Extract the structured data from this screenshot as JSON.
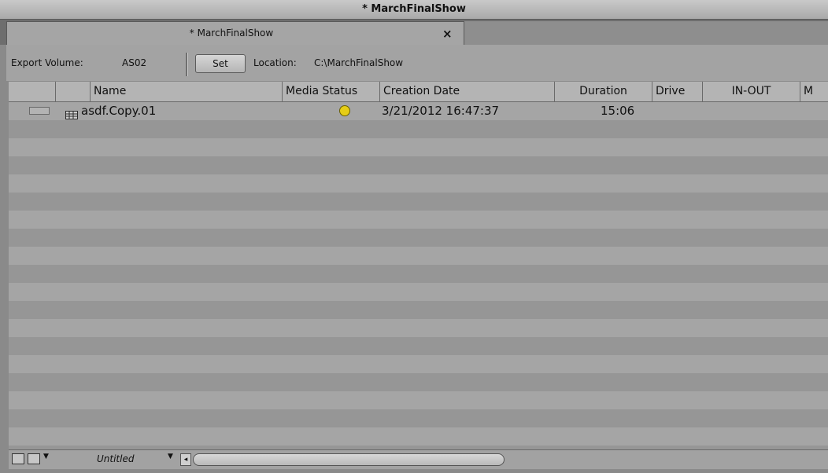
{
  "window": {
    "title": "* MarchFinalShow"
  },
  "tab": {
    "label": "* MarchFinalShow",
    "close": "×"
  },
  "toolbar": {
    "export_label": "Export Volume:",
    "export_value": "AS02",
    "set_label": "Set",
    "location_label": "Location:",
    "location_value": "C:\\MarchFinalShow"
  },
  "columns": [
    "Name",
    "Media Status",
    "Creation Date",
    "Duration",
    "Drive",
    "IN-OUT",
    "M"
  ],
  "rows": [
    {
      "name": "asdf.Copy.01",
      "media_status": "online",
      "creation_date": "3/21/2012 16:47:37",
      "duration": "15:06",
      "drive": "",
      "in_out": ""
    }
  ],
  "statusbar": {
    "view_name": "Untitled",
    "view_arrow": "▼",
    "scroll_left": "◂"
  },
  "colors": {
    "status_dot": "#e6cd16"
  }
}
